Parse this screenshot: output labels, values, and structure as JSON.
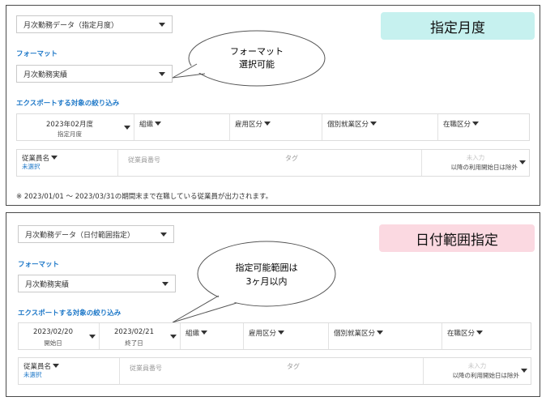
{
  "panel1": {
    "data_type_select": "月次勤務データ（指定月度）",
    "banner": "指定月度",
    "format_label": "フォーマット",
    "format_select": "月次勤務実績",
    "bubble": [
      "フォーマット",
      "選択可能"
    ],
    "filter_label": "エクスポートする対象の絞り込み",
    "month": {
      "value": "2023年02月度",
      "sub": "指定月度"
    },
    "filters": [
      "組織",
      "雇用区分",
      "個別就業区分",
      "在職区分"
    ],
    "employee": {
      "title": "従業員名",
      "sub": "未選択"
    },
    "employee_number_placeholder": "従業員番号",
    "tag_placeholder": "タグ",
    "date_field": {
      "placeholder": "未入力",
      "note": "以降の利用開始日は除外"
    },
    "footer_note": "※ 2023/01/01 ～ 2023/03/31の期間末まで在職している従業員が出力されます。"
  },
  "panel2": {
    "data_type_select": "月次勤務データ（日付範囲指定）",
    "banner": "日付範囲指定",
    "format_label": "フォーマット",
    "format_select": "月次勤務実績",
    "bubble": [
      "指定可能範囲は",
      "3ヶ月以内"
    ],
    "filter_label": "エクスポートする対象の絞り込み",
    "start": {
      "value": "2023/02/20",
      "sub": "開始日"
    },
    "end": {
      "value": "2023/02/21",
      "sub": "終了日"
    },
    "filters": [
      "組織",
      "雇用区分",
      "個別就業区分",
      "在職区分"
    ],
    "employee": {
      "title": "従業員名",
      "sub": "未選択"
    },
    "employee_number_placeholder": "従業員番号",
    "tag_placeholder": "タグ",
    "date_field": {
      "placeholder": "未入力",
      "note": "以降の利用開始日は除外"
    }
  },
  "colors": {
    "banner1": "#c6f1ef",
    "banner2": "#fbd9e1",
    "accent": "#1e78c8"
  }
}
